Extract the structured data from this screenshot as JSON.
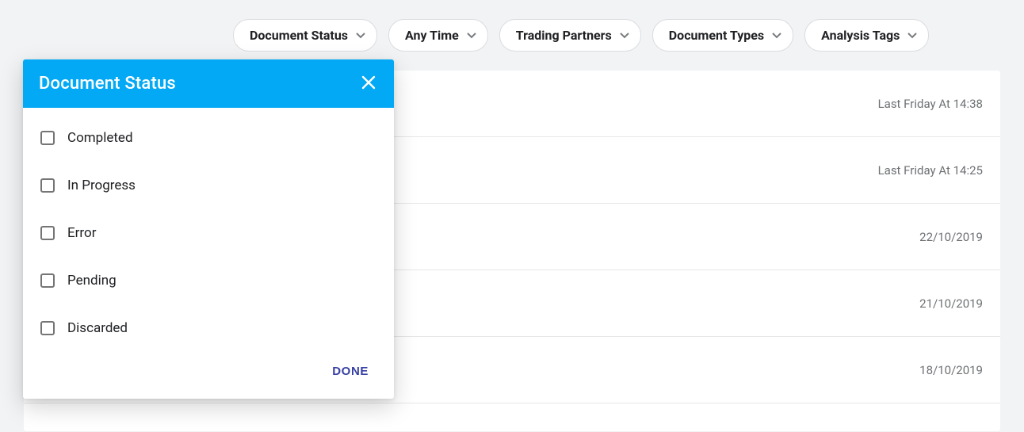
{
  "filters": {
    "document_status": "Document Status",
    "any_time": "Any Time",
    "trading_partners": "Trading Partners",
    "document_types": "Document Types",
    "analysis_tags": "Analysis Tags"
  },
  "rows": [
    {
      "timestamp": "Last Friday At 14:38"
    },
    {
      "timestamp": "Last Friday At 14:25"
    },
    {
      "timestamp": "22/10/2019"
    },
    {
      "timestamp": "21/10/2019"
    },
    {
      "timestamp": "18/10/2019"
    }
  ],
  "popover": {
    "title": "Document Status",
    "options": [
      {
        "label": "Completed",
        "checked": false
      },
      {
        "label": "In Progress",
        "checked": false
      },
      {
        "label": "Error",
        "checked": false
      },
      {
        "label": "Pending",
        "checked": false
      },
      {
        "label": "Discarded",
        "checked": false
      }
    ],
    "done_label": "DONE"
  },
  "colors": {
    "accent": "#03a9f4",
    "done": "#3740a3"
  }
}
